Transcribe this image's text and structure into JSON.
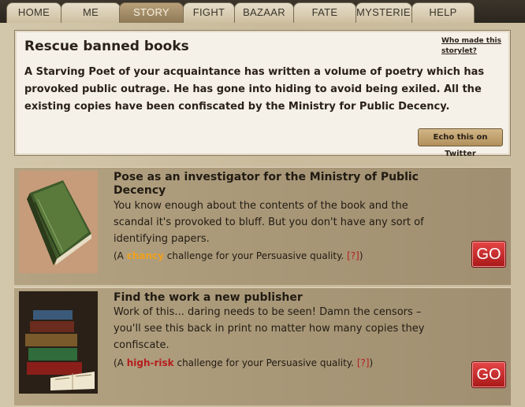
{
  "tabs": [
    {
      "label": "HOME"
    },
    {
      "label": "ME"
    },
    {
      "label": "STORY"
    },
    {
      "label": "FIGHT"
    },
    {
      "label": "BAZAAR"
    },
    {
      "label": "FATE"
    },
    {
      "label": "MYSTERIES"
    },
    {
      "label": "HELP"
    }
  ],
  "active_tab": "STORY",
  "storylet": {
    "title": "Rescue banned books",
    "description": "A Starving Poet of your acquaintance has written a volume of poetry which has provoked public outrage. He has gone into hiding to avoid being exiled. All the existing copies have been confiscated by the Ministry for Public Decency.",
    "who_made": "Who made this storylet?",
    "echo_button": "Echo this on Twitter"
  },
  "branches": [
    {
      "title": "Pose as an investigator for the Ministry of Public Decency",
      "description": "You know enough about the contents of the book and the scandal it's provoked to bluff. But you don't have any sort of identifying papers.",
      "challenge_prefix": "(A ",
      "challenge_level": "chancy",
      "challenge_suffix": " challenge for your Persuasive quality. ",
      "help": "[?]",
      "close": ")",
      "go": "GO",
      "image": "green-book-icon"
    },
    {
      "title": "Find the work a new publisher",
      "description": "Work of this... daring needs to be seen! Damn the censors – you'll see this back in print no matter how many copies they confiscate.",
      "challenge_prefix": "(A ",
      "challenge_level": "high-risk",
      "challenge_suffix": " challenge for your Persuasive quality. ",
      "help": "[?]",
      "close": ")",
      "go": "GO",
      "image": "book-stack-icon"
    }
  ]
}
